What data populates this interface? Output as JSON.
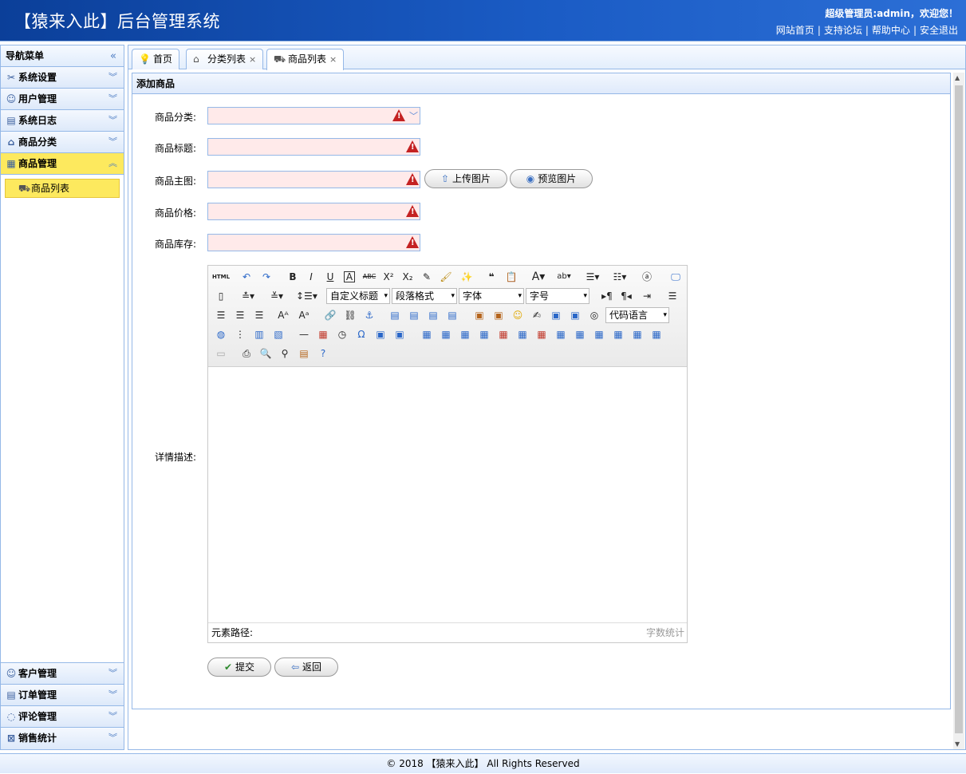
{
  "header": {
    "title": "【猿来入此】后台管理系统",
    "welcome": "超级管理员:admin，欢迎您！",
    "links": [
      "网站首页",
      "支持论坛",
      "帮助中心",
      "安全退出"
    ]
  },
  "sidebar": {
    "title": "导航菜单",
    "collapse": "«",
    "top_items": [
      {
        "label": "系统设置",
        "icon": "wrench-icon"
      },
      {
        "label": "用户管理",
        "icon": "users-icon"
      },
      {
        "label": "系统日志",
        "icon": "log-icon"
      },
      {
        "label": "商品分类",
        "icon": "category-icon"
      },
      {
        "label": "商品管理",
        "icon": "goods-icon"
      }
    ],
    "sub_item": "商品列表",
    "bottom_items": [
      {
        "label": "客户管理",
        "icon": "customer-icon"
      },
      {
        "label": "订单管理",
        "icon": "order-icon"
      },
      {
        "label": "评论管理",
        "icon": "comment-icon"
      },
      {
        "label": "销售统计",
        "icon": "stats-icon"
      }
    ]
  },
  "tabs": [
    "首页",
    "分类列表",
    "商品列表"
  ],
  "panel": {
    "title": "添加商品",
    "fields": {
      "category": "商品分类:",
      "title": "商品标题:",
      "image": "商品主图:",
      "price": "商品价格:",
      "stock": "商品库存:",
      "detail": "详情描述:"
    },
    "upload_btn": "上传图片",
    "preview_btn": "预览图片",
    "submit_btn": "提交",
    "back_btn": "返回"
  },
  "editor": {
    "html_btn": "HTML",
    "custom_title": "自定义标题",
    "paragraph": "段落格式",
    "font": "字体",
    "font_size": "字号",
    "code_lang": "代码语言",
    "path_label": "元素路径:",
    "word_count": "字数统计"
  },
  "footer": "© 2018 【猿来入此】 All Rights Reserved",
  "colors": {
    "header": "#1a5bc4",
    "active": "#fde95e",
    "border": "#95b8e7",
    "warn": "#c42222"
  }
}
